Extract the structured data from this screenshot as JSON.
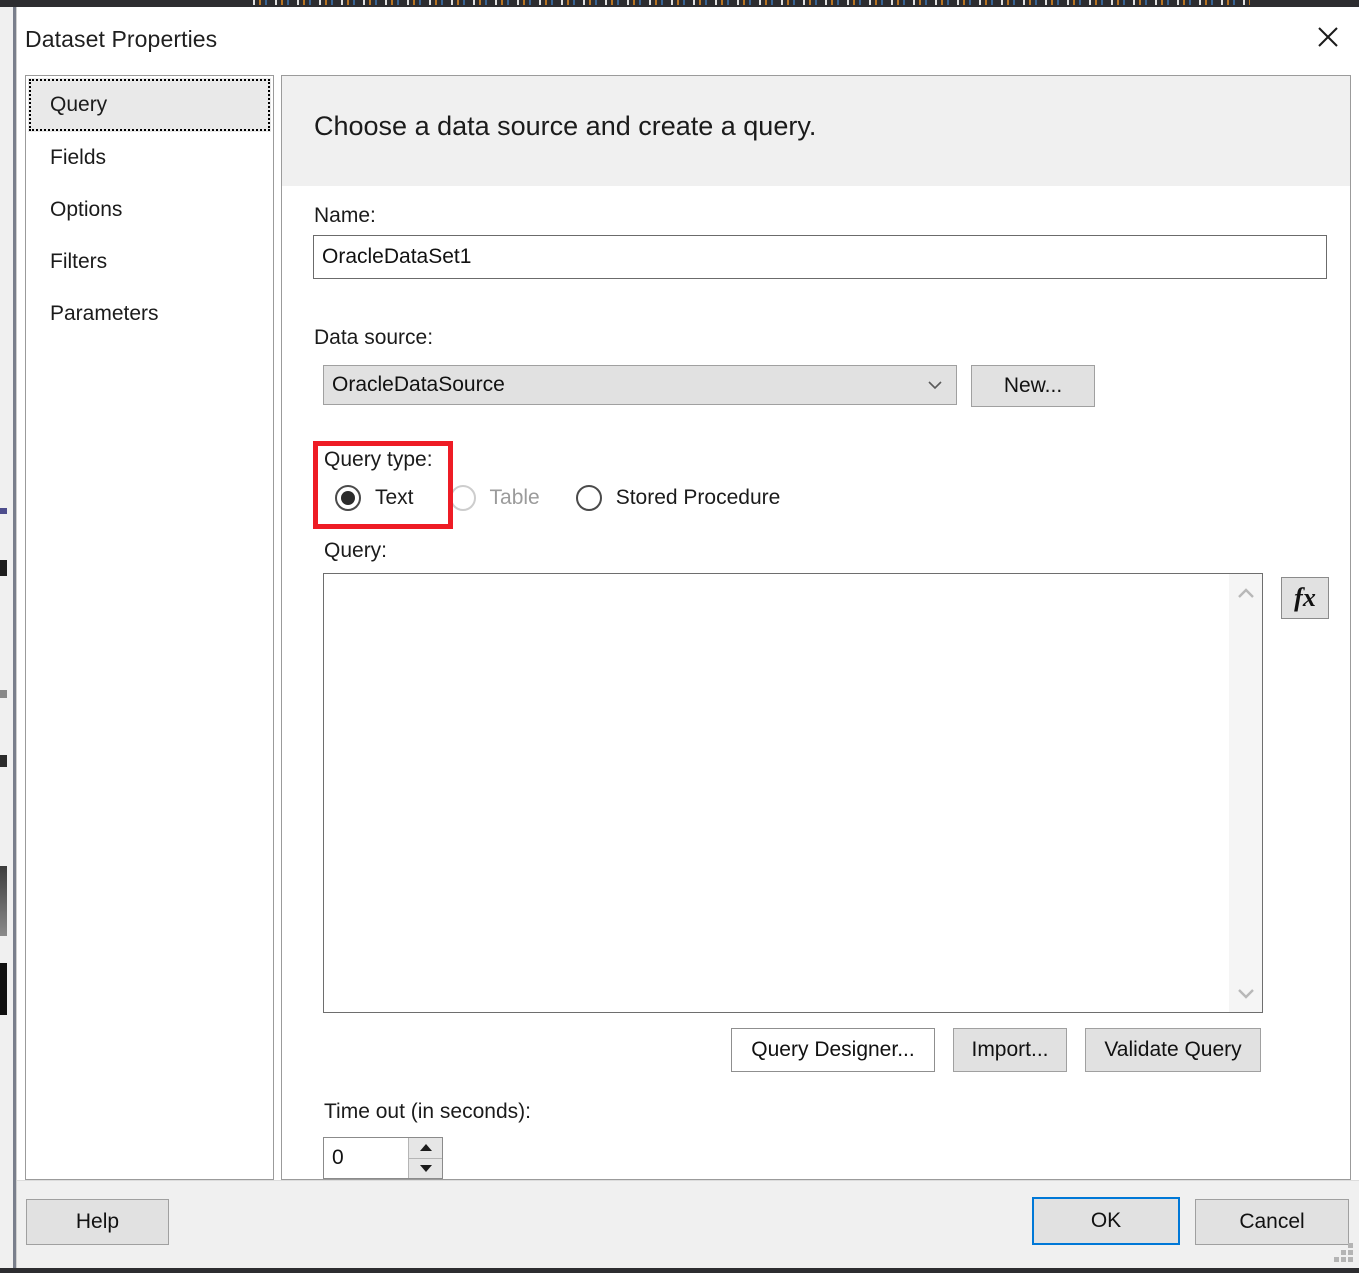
{
  "window": {
    "title": "Dataset Properties",
    "close_icon": "close-icon"
  },
  "sidebar": {
    "items": [
      {
        "label": "Query",
        "selected": true
      },
      {
        "label": "Fields",
        "selected": false
      },
      {
        "label": "Options",
        "selected": false
      },
      {
        "label": "Filters",
        "selected": false
      },
      {
        "label": "Parameters",
        "selected": false
      }
    ]
  },
  "content": {
    "heading": "Choose a data source and create a query.",
    "name": {
      "label": "Name:",
      "value": "OracleDataSet1",
      "placeholder": ""
    },
    "data_source": {
      "label": "Data source:",
      "value": "OracleDataSource",
      "chevron_icon": "chevron-down-icon",
      "new_button": "New..."
    },
    "query_type": {
      "label": "Query type:",
      "options": [
        {
          "label": "Text",
          "selected": true,
          "disabled": false
        },
        {
          "label": "Table",
          "selected": false,
          "disabled": true
        },
        {
          "label": "Stored Procedure",
          "selected": false,
          "disabled": false
        }
      ],
      "highlight_color": "#ee1c25"
    },
    "query": {
      "label": "Query:",
      "value": "",
      "placeholder": "",
      "scrollbar_up_icon": "chevron-up-icon",
      "scrollbar_down_icon": "chevron-down-icon",
      "expression_button": "fx",
      "expression_icon": "function-fx-icon"
    },
    "query_buttons": [
      {
        "label": "Query Designer...",
        "style": "white"
      },
      {
        "label": "Import...",
        "style": "gray"
      },
      {
        "label": "Validate Query",
        "style": "gray"
      }
    ],
    "timeout": {
      "label": "Time out (in seconds):",
      "value": "0",
      "up_icon": "spinner-up-icon",
      "down_icon": "spinner-down-icon"
    }
  },
  "footer": {
    "help_label": "Help",
    "ok_label": "OK",
    "cancel_label": "Cancel",
    "accent_color": "#0078d7",
    "resize_grip_icon": "resize-grip-icon"
  }
}
